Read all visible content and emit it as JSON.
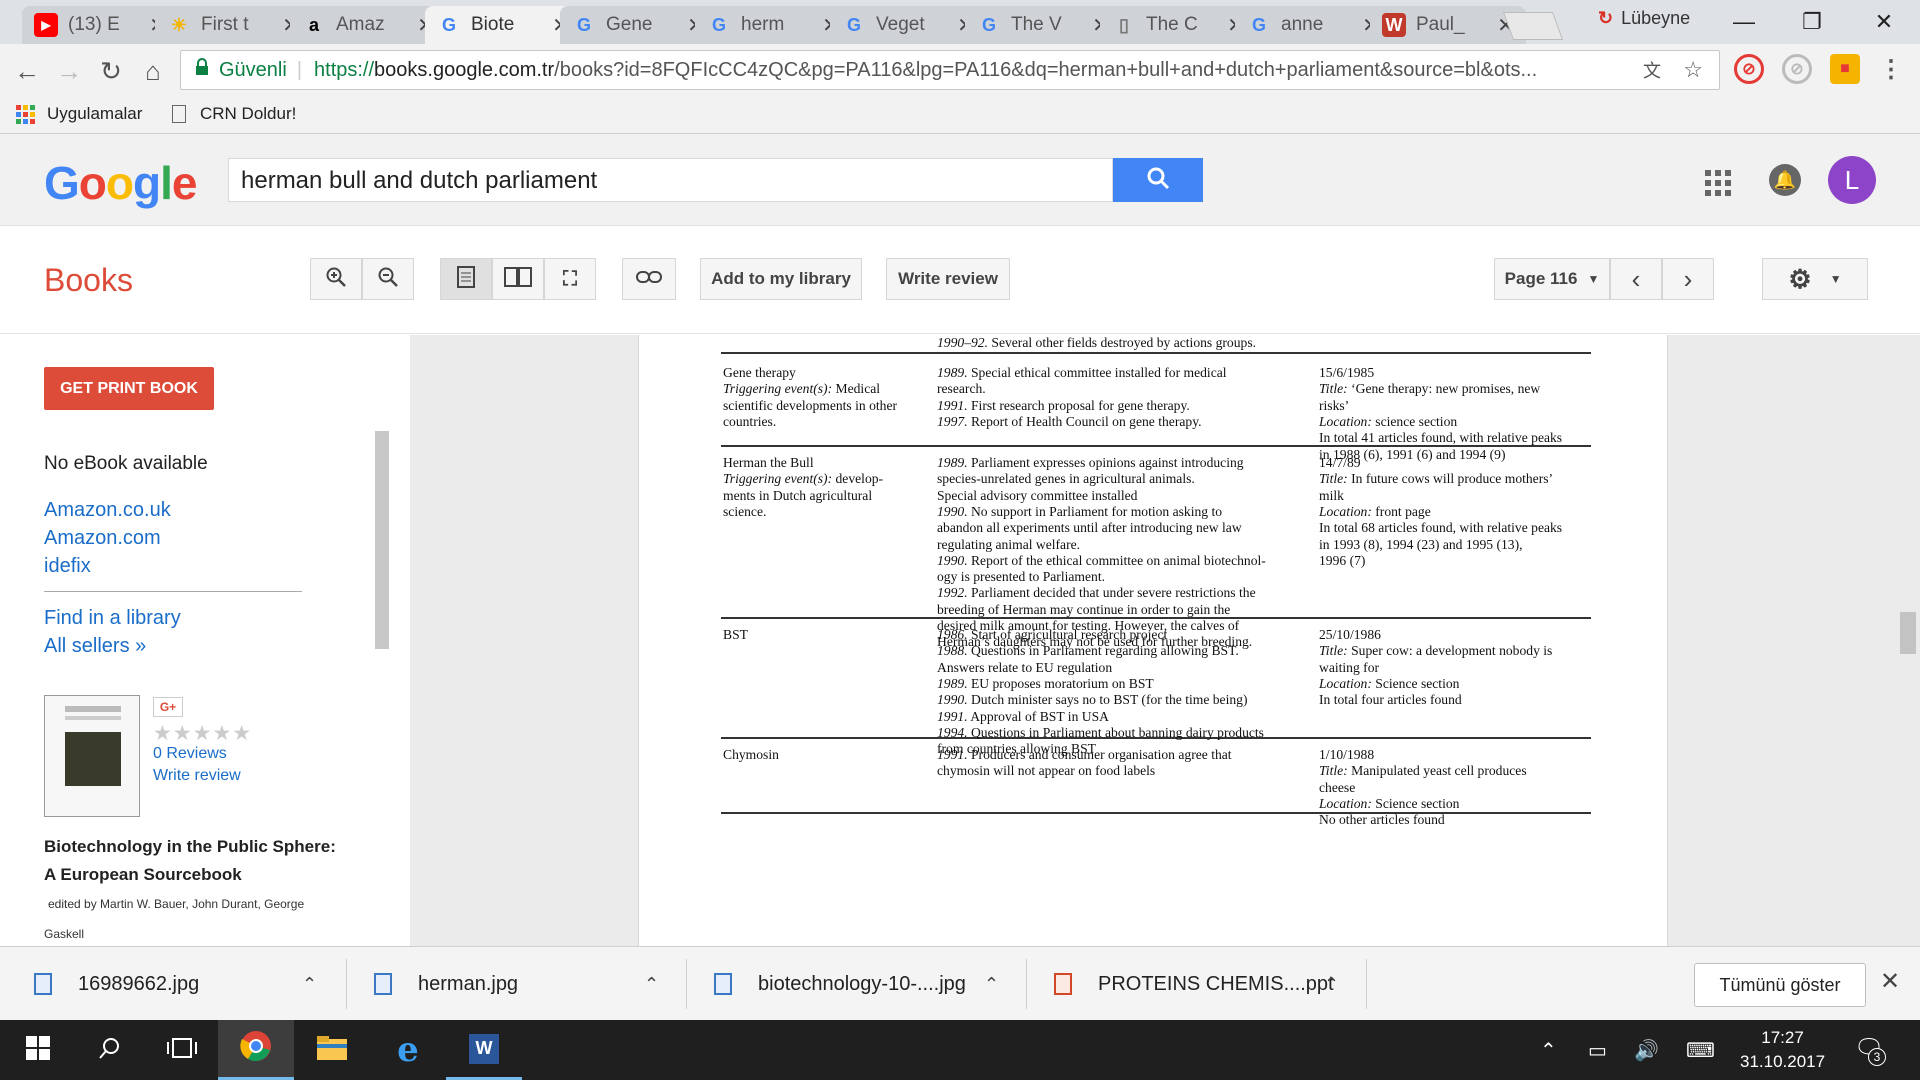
{
  "browser": {
    "tabs": [
      {
        "label": "(13) E",
        "favicon": "youtube-icon",
        "color": "#ff0000"
      },
      {
        "label": "First t",
        "favicon": "sun-icon",
        "color": "#f4b400"
      },
      {
        "label": "Amaz",
        "favicon": "amazon-icon",
        "color": "#000000"
      },
      {
        "label": "Biote",
        "favicon": "google-icon",
        "color": "#4285f4",
        "active": true
      },
      {
        "label": "Gene",
        "favicon": "google-icon",
        "color": "#4285f4"
      },
      {
        "label": "herm",
        "favicon": "google-icon",
        "color": "#4285f4"
      },
      {
        "label": "Veget",
        "favicon": "google-icon",
        "color": "#4285f4"
      },
      {
        "label": "The V",
        "favicon": "google-icon",
        "color": "#4285f4"
      },
      {
        "label": "The C",
        "favicon": "document-icon",
        "color": "#777777"
      },
      {
        "label": "anne",
        "favicon": "google-icon",
        "color": "#4285f4"
      },
      {
        "label": "Paul_",
        "favicon": "word-w-icon",
        "color": "#c0392b"
      }
    ],
    "profile_name": "Lübeyne",
    "secure_label": "Güvenli",
    "url_scheme": "https://",
    "url_host": "books.google.com.tr",
    "url_path": "/books?id=8FQFIcCC4zQC&pg=PA116&lpg=PA116&dq=herman+bull+and+dutch+parliament&source=bl&ots...",
    "bookmarks": [
      {
        "label": "Uygulamalar",
        "icon": "apps-grid-icon"
      },
      {
        "label": "CRN Doldur!",
        "icon": "page-icon"
      }
    ]
  },
  "google": {
    "logo": "Google",
    "query": "herman bull and dutch parliament",
    "avatar_letter": "L"
  },
  "books": {
    "title": "Books",
    "add_library": "Add to my library",
    "write_review": "Write review",
    "page_label": "Page 116"
  },
  "sidebar": {
    "get_print": "GET PRINT BOOK",
    "no_ebook": "No eBook available",
    "sellers": [
      "Amazon.co.uk",
      "Amazon.com",
      "idefix"
    ],
    "find_library": "Find in a library",
    "all_sellers": "All sellers »",
    "gplus": "G+",
    "stars": "★★★★★",
    "reviews": "0 Reviews",
    "write_review": "Write review",
    "book_title_1": "Biotechnology in the Public Sphere:",
    "book_title_2": "A European Sourcebook",
    "authors_1": "edited by Martin W. Bauer, John Durant, George",
    "authors_2": "Gaskell"
  },
  "page_content": {
    "top_line": "1990–92. Several other fields destroyed by actions groups.",
    "rows": [
      {
        "col1": [
          "Gene therapy",
          "Triggering event(s): Medical",
          "scientific developments in other",
          "countries."
        ],
        "col2": [
          "1989. Special ethical committee installed  for medical",
          "research.",
          "1991. First research proposal  for gene therapy.",
          "1997. Report of Health Council on gene therapy."
        ],
        "col3": [
          "15/6/1985",
          "Title: ‘Gene therapy: new promises, new",
          "risks’",
          "Location: science section",
          "In total 41 articles found, with relative peaks",
          "in 1988 (6), 1991 (6) and 1994 (9)"
        ]
      },
      {
        "col1": [
          "Herman the Bull",
          "Triggering event(s): develop-",
          "ments in Dutch agricultural",
          "science."
        ],
        "col2": [
          "1989. Parliament expresses opinions against introducing",
          "species-unrelated genes in agricultural animals.",
          "Special advisory committee installed",
          "1990. No support in Parliament for motion asking to",
          "abandon all experiments until after introducing new law",
          "regulating animal welfare.",
          "1990. Report of the ethical committee on animal biotechnol-",
          "ogy is presented to Parliament.",
          "1992. Parliament decided that under severe restrictions the",
          "breeding of Herman may continue in order to gain the",
          "desired milk amount for testing. However, the calves of",
          "Herman’s daughters may not be used for further breeding."
        ],
        "col3": [
          "14/7/89",
          "Title: In future cows will produce mothers’",
          "milk",
          "Location: front page",
          "In total 68 articles found, with relative peaks",
          "in 1993 (8), 1994 (23) and 1995 (13),",
          "1996 (7)"
        ]
      },
      {
        "col1": [
          "BST"
        ],
        "col2": [
          "1986. Start of agricultural research project",
          "1988. Questions in Parliament regarding allowing BST.",
          "Answers relate to EU regulation",
          "1989. EU proposes moratorium on BST",
          "1990. Dutch minister says no to BST (for the time being)",
          "1991. Approval of BST in USA",
          "1994. Questions in Parliament about banning dairy products",
          "from countries allowing BST"
        ],
        "col3": [
          "25/10/1986",
          "Title: Super cow: a development nobody is",
          "waiting for",
          "Location: Science section",
          "In total four articles found"
        ]
      },
      {
        "col1": [
          "Chymosin"
        ],
        "col2": [
          "1991. Producers and consumer organisation agree that",
          "chymosin will not appear on food labels"
        ],
        "col3": [
          "1/10/1988",
          "Title: Manipulated yeast cell produces",
          "cheese",
          "Location: Science section",
          "No other articles found"
        ]
      }
    ]
  },
  "downloads": {
    "items": [
      "16989662.jpg",
      "herman.jpg",
      "biotechnology-10-....jpg",
      "PROTEINS CHEMIS....ppt"
    ],
    "show_all": "Tümünü göster"
  },
  "taskbar": {
    "time": "17:27",
    "date": "31.10.2017",
    "notifications": "3"
  }
}
